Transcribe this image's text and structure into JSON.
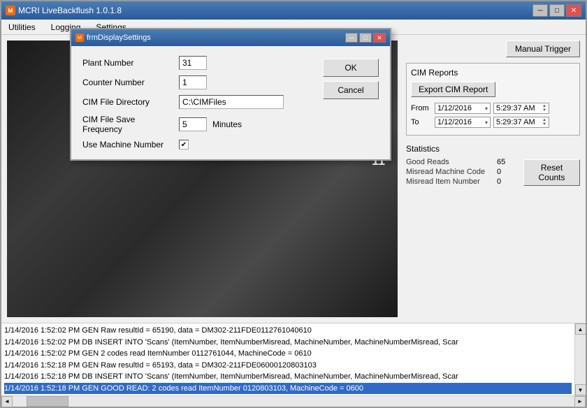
{
  "mainWindow": {
    "title": "MCRI LiveBackflush 1.0.1.8",
    "icon": "M"
  },
  "menu": {
    "items": [
      "Utilities",
      "Logging",
      "Settings"
    ]
  },
  "modal": {
    "title": "frmDisplaySettings",
    "form": {
      "plantNumberLabel": "Plant Number",
      "plantNumberValue": "31",
      "counterNumberLabel": "Counter Number",
      "counterNumberValue": "1",
      "cimFileDirectoryLabel": "CIM File Directory",
      "cimFileDirectoryValue": "C:\\CIMFiles",
      "cimFileSaveFreqLabel": "CIM File Save Frequency",
      "cimFileSaveFreqValue": "5",
      "cimFileSaveFreqUnit": "Minutes",
      "useMachineNumberLabel": "Use Machine Number",
      "useMachineNumberChecked": true
    },
    "buttons": {
      "ok": "OK",
      "cancel": "Cancel"
    }
  },
  "rightPanel": {
    "manualTrigger": "Manual Trigger",
    "cimReports": {
      "label": "CIM Reports",
      "exportButton": "Export CIM Report",
      "fromLabel": "From",
      "fromDate": "1/12/2016",
      "fromTime": "5:29:37 AM",
      "toLabel": "To",
      "toDate": "1/12/2016",
      "toTime": "5:29:37 AM"
    },
    "statistics": {
      "label": "Statistics",
      "goodReads": {
        "label": "Good Reads",
        "value": "65"
      },
      "misreadMachineCode": {
        "label": "Misread Machine Code",
        "value": "0"
      },
      "misreadItemNumber": {
        "label": "Misread Item Number",
        "value": "0"
      },
      "resetCounts": "Reset Counts"
    }
  },
  "log": {
    "lines": [
      {
        "text": "1/14/2016 1:52:02 PM GEN  Raw resultId = 65190, data = DM302-211FDE0112761040610",
        "highlighted": false
      },
      {
        "text": "1/14/2016 1:52:02 PM DB  INSERT INTO 'Scans' (ItemNumber, ItemNumberMisread, MachineNumber, MachineNumberMisread, Scar",
        "highlighted": false
      },
      {
        "text": "1/14/2016 1:52:02 PM GEN  2 codes read ItemNumber 0112761044, MachineCode = 0610",
        "highlighted": false
      },
      {
        "text": "1/14/2016 1:52:18 PM GEN  Raw resultId = 65193, data = DM302-211FDE06000120803103",
        "highlighted": false
      },
      {
        "text": "1/14/2016 1:52:18 PM DB  INSERT INTO 'Scans' (ItemNumber, ItemNumberMisread, MachineNumber, MachineNumberMisread, Scar",
        "highlighted": false
      },
      {
        "text": "1/14/2016 1:52:18 PM GEN  GOOD READ: 2 codes read ItemNumber 0120803103, MachineCode = 0600",
        "highlighted": true
      }
    ]
  },
  "icons": {
    "minimize": "─",
    "maximize": "□",
    "close": "✕",
    "chevronDown": "▾",
    "spinUp": "▲",
    "spinDown": "▼",
    "scrollLeft": "◄",
    "scrollRight": "►",
    "scrollUp": "▲",
    "scrollDown": "▼",
    "check": "✔"
  }
}
